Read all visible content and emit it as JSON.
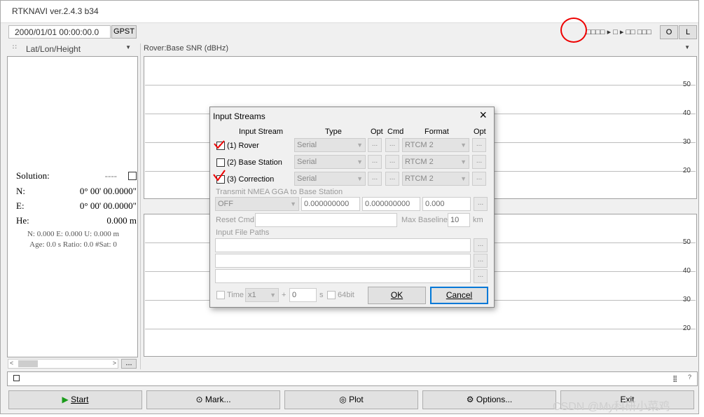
{
  "window": {
    "title": "RTKNAVI ver.2.4.3 b34"
  },
  "toolbar": {
    "time": "2000/01/01 00:00:00.0",
    "timesys": "GPST",
    "status_glyphs": "□□□□ ▸ □ ▸ □□ □□□",
    "btn_o": "O",
    "btn_l": "L",
    "close_glyph": "×"
  },
  "left_panel": {
    "dropdown": "Lat/Lon/Height",
    "solution_label": "Solution:",
    "solution_value": "----",
    "rows": [
      {
        "k": "N:",
        "v": "0° 00' 00.0000\""
      },
      {
        "k": "E:",
        "v": "0° 00' 00.0000\""
      },
      {
        "k": "He:",
        "v": "0.000 m"
      }
    ],
    "info1": "N: 0.000 E: 0.000 U: 0.000 m",
    "info2": "Age: 0.0 s Ratio: 0.0 #Sat: 0",
    "more_btn": "..."
  },
  "right_panel": {
    "dropdown": "Rover:Base  SNR (dBHz)",
    "ticks": [
      "50",
      "40",
      "30",
      "20"
    ]
  },
  "bottom": {
    "start": "Start",
    "mark": "Mark...",
    "plot": "Plot",
    "options": "Options...",
    "exit": "Exit",
    "watermark": "CSDN @My科研小菜鸡"
  },
  "dialog": {
    "title": "Input Streams",
    "close": "×",
    "headers": {
      "stream": "Input Stream",
      "type": "Type",
      "opt": "Opt",
      "cmd": "Cmd",
      "format": "Format",
      "opt2": "Opt"
    },
    "streams": [
      {
        "label": "(1) Rover",
        "type": "Serial",
        "format": "RTCM 2",
        "checked": true
      },
      {
        "label": "(2) Base Station",
        "type": "Serial",
        "format": "RTCM 2",
        "checked": false
      },
      {
        "label": "(3) Correction",
        "type": "Serial",
        "format": "RTCM 2",
        "checked": false
      }
    ],
    "nmea_label": "Transmit NMEA GGA to Base Station",
    "nmea_mode": "OFF",
    "nmea_lat": "0.000000000",
    "nmea_lon": "0.000000000",
    "nmea_h": "0.000",
    "reset_cmd": "Reset Cmd",
    "max_baseline": "Max Baseline",
    "max_baseline_val": "10",
    "km": "km",
    "file_paths": "Input File Paths",
    "time": "Time",
    "speed": "x1",
    "plus": "+",
    "offset": "0",
    "s": "s",
    "bit64": "64bit",
    "ok": "OK",
    "cancel": "Cancel",
    "dots": "..."
  }
}
